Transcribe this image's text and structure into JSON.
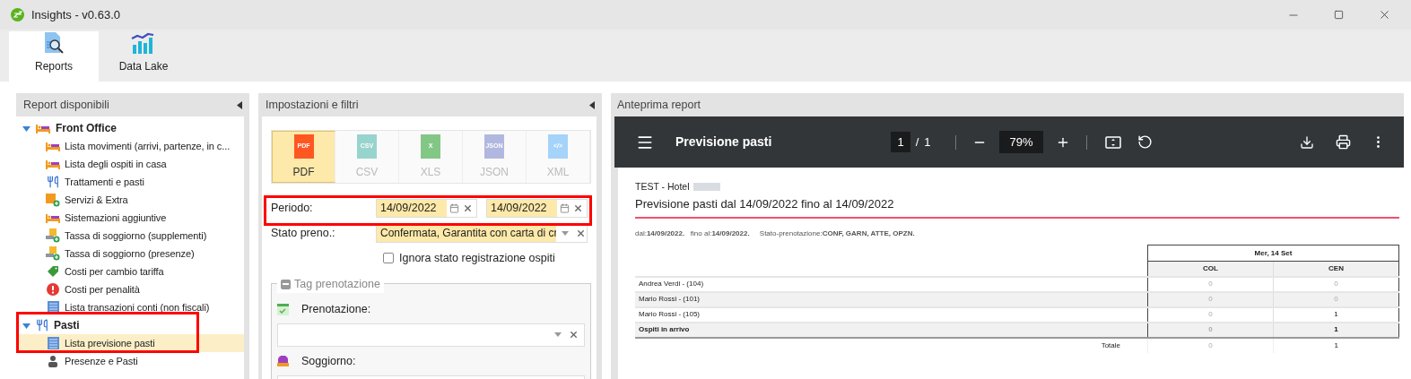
{
  "window": {
    "title": "Insights - v0.63.0"
  },
  "ribbon_tabs": [
    {
      "label": "Reports",
      "selected": true
    },
    {
      "label": "Data Lake",
      "selected": false
    }
  ],
  "reports_panel": {
    "title": "Report disponibili",
    "tree": [
      {
        "label": "Front Office",
        "expanded": true,
        "selected": false,
        "children": [
          {
            "label": "Lista movimenti (arrivi, partenze, in c...",
            "selected": false
          },
          {
            "label": "Lista degli ospiti in casa",
            "selected": false
          },
          {
            "label": "Trattamenti e pasti",
            "selected": false
          },
          {
            "label": "Servizi & Extra",
            "selected": false
          },
          {
            "label": "Sistemazioni aggiuntive",
            "selected": false
          },
          {
            "label": "Tassa di soggiorno (supplementi)",
            "selected": false
          },
          {
            "label": "Tassa di soggiorno (presenze)",
            "selected": false
          },
          {
            "label": "Costi per cambio tariffa",
            "selected": false
          },
          {
            "label": "Costi per penalità",
            "selected": false
          },
          {
            "label": "Lista transazioni conti (non fiscali)",
            "selected": false
          }
        ]
      },
      {
        "label": "Pasti",
        "expanded": true,
        "selected": false,
        "children": [
          {
            "label": "Lista previsione pasti",
            "selected": true
          },
          {
            "label": "Presenze e Pasti",
            "selected": false
          }
        ]
      }
    ]
  },
  "settings_panel": {
    "title": "Impostazioni e filtri",
    "formats": [
      {
        "label": "PDF",
        "icon_text": "PDF",
        "selected": true
      },
      {
        "label": "CSV",
        "icon_text": "CSV",
        "selected": false
      },
      {
        "label": "XLS",
        "icon_text": "X",
        "selected": false
      },
      {
        "label": "JSON",
        "icon_text": "JSON",
        "selected": false
      },
      {
        "label": "XML",
        "icon_text": "</>",
        "selected": false
      }
    ],
    "period": {
      "label": "Periodo:",
      "from": "14/09/2022",
      "to": "14/09/2022"
    },
    "booking_status": {
      "label": "Stato preno.:",
      "value": "Confermata, Garantita con carta di cr"
    },
    "ignore_checkbox": {
      "label": "Ignora stato registrazione ospiti",
      "checked": false
    },
    "tag_group": {
      "title": "Tag prenotazione",
      "expanded": true,
      "fields": [
        {
          "label": "Prenotazione:"
        },
        {
          "label": "Soggiorno:"
        }
      ]
    }
  },
  "preview_panel": {
    "title": "Anteprima report",
    "toolbar": {
      "title": "Previsione pasti",
      "page": "1",
      "page_sep": "/",
      "pages": "1",
      "zoom": "79%"
    },
    "report": {
      "hotel": "TEST - Hotel",
      "heading": "Previsione pasti dal 14/09/2022 fino al 14/09/2022",
      "filters": "dal:**14/09/2022.**   fino al:**14/09/2022.**     Stato-prenotazione:**CONF, GARN, ATTE, OPZN.**",
      "day_header": "Mer, 14 Set",
      "columns": [
        "COL",
        "CEN"
      ],
      "rows": [
        {
          "name": "Andrea Verdi - (104)",
          "bold": false,
          "cells": [
            {
              "text": "0",
              "dim": true
            },
            {
              "text": "0",
              "dim": true
            }
          ]
        },
        {
          "name": "Mario Rossi - (101)",
          "bold": false,
          "cells": [
            {
              "text": "0",
              "dim": true
            },
            {
              "text": "0",
              "dim": true
            }
          ]
        },
        {
          "name": "Mario Rossi - (105)",
          "bold": false,
          "cells": [
            {
              "text": "0",
              "dim": true
            },
            {
              "text": "1",
              "dim": false
            }
          ]
        },
        {
          "name": "Ospiti in arrivo",
          "bold": true,
          "cells": [
            {
              "text": "0",
              "dim": true
            },
            {
              "text": "1",
              "dim": false
            }
          ]
        }
      ],
      "total": {
        "label": "Totale",
        "cells": [
          {
            "text": "0",
            "dim": true
          },
          {
            "text": "1",
            "dim": false
          }
        ]
      }
    }
  }
}
